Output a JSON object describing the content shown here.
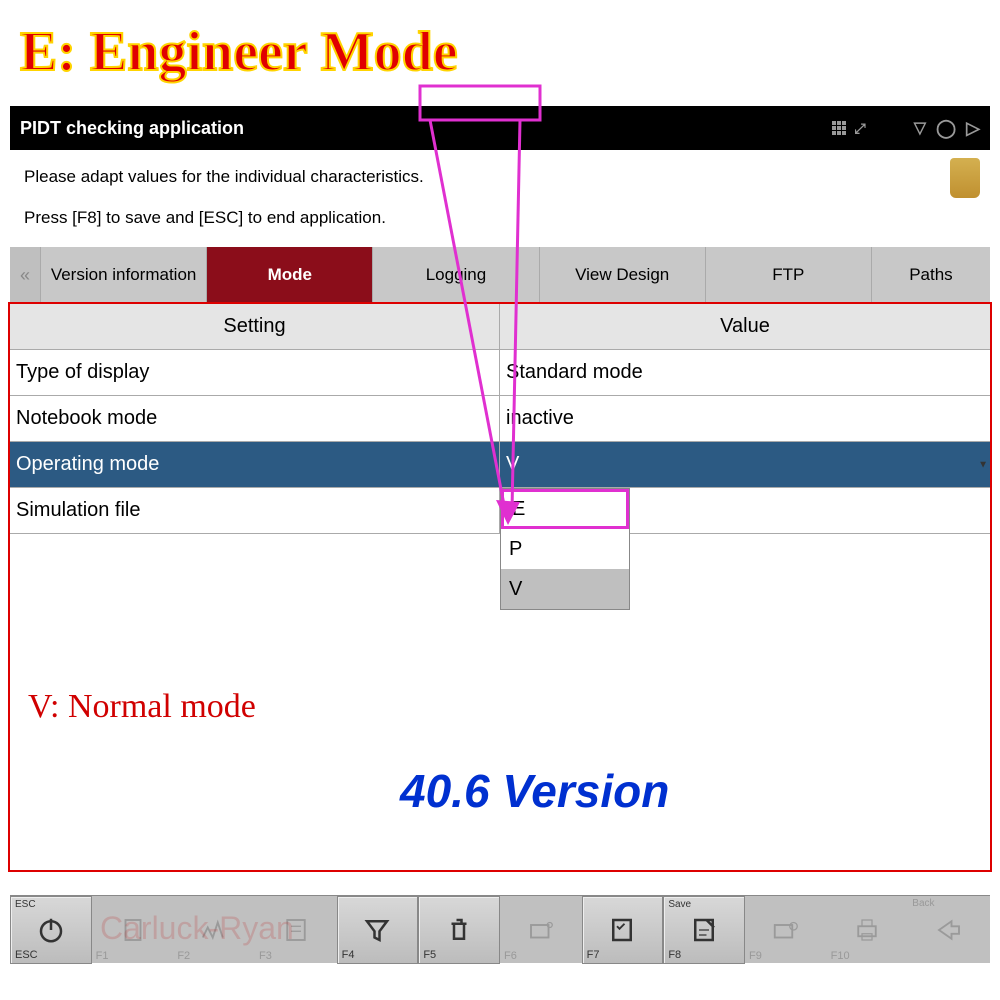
{
  "overlay": {
    "title": "E:   Engineer Mode",
    "normal_mode": "V: Normal  mode",
    "version": "40.6 Version",
    "watermark": "Carluck-Ryan"
  },
  "titlebar": {
    "title": "PIDT checking application"
  },
  "instructions": {
    "line1": "Please adapt values for the individual characteristics.",
    "line2": "Press [F8] to save and [ESC] to end application."
  },
  "tabs": {
    "scroll_left": "«",
    "items": [
      "Version information",
      "Mode",
      "Logging",
      "View Design",
      "FTP",
      "Paths"
    ]
  },
  "table": {
    "header_setting": "Setting",
    "header_value": "Value",
    "rows": [
      {
        "setting": "Type of display",
        "value": "Standard mode"
      },
      {
        "setting": "Notebook mode",
        "value": "inactive"
      },
      {
        "setting": "Operating mode",
        "value": "V"
      },
      {
        "setting": "Simulation file",
        "value": ""
      }
    ]
  },
  "dropdown": {
    "options": [
      "E",
      "P",
      "V"
    ]
  },
  "toolbar": {
    "esc_top": "ESC",
    "esc_bot": "ESC",
    "save_top": "Save",
    "f1": "F1",
    "f2": "F2",
    "f3": "F3",
    "f4": "F4",
    "f5": "F5",
    "f6": "F6",
    "f7": "F7",
    "f8": "F8",
    "f9": "F9",
    "f10": "F10",
    "back": "Back"
  }
}
